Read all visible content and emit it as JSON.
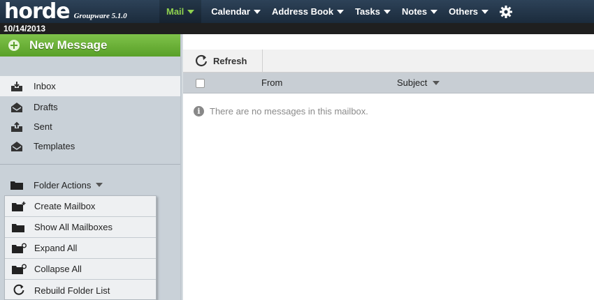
{
  "header": {
    "logo_text": "horde",
    "logo_subtitle": "Groupware 5.1.0",
    "nav": [
      {
        "label": "Mail"
      },
      {
        "label": "Calendar"
      },
      {
        "label": "Address Book"
      },
      {
        "label": "Tasks"
      },
      {
        "label": "Notes"
      },
      {
        "label": "Others"
      }
    ],
    "settings_icon": "gear-icon"
  },
  "date": "10/14/2013",
  "sidebar": {
    "new_message_label": "New Message",
    "mailboxes": [
      {
        "label": "Inbox",
        "icon": "inbox-icon",
        "selected": true
      },
      {
        "label": "Drafts",
        "icon": "drafts-icon",
        "selected": false
      },
      {
        "label": "Sent",
        "icon": "sent-icon",
        "selected": false
      },
      {
        "label": "Templates",
        "icon": "templates-icon",
        "selected": false
      }
    ],
    "folder_actions_label": "Folder Actions",
    "folder_menu": [
      {
        "label": "Create Mailbox",
        "icon": "folder-new-icon"
      },
      {
        "label": "Show All Mailboxes",
        "icon": "folder-icon"
      },
      {
        "label": "Expand All",
        "icon": "folder-expand-icon"
      },
      {
        "label": "Collapse All",
        "icon": "folder-collapse-icon"
      },
      {
        "label": "Rebuild Folder List",
        "icon": "refresh-icon"
      }
    ]
  },
  "toolbar": {
    "refresh_label": "Refresh"
  },
  "message_list": {
    "columns": [
      "From",
      "Subject"
    ],
    "empty_text": "There are no messages in this mailbox."
  },
  "colors": {
    "topbar": "#1b2b3c",
    "active_nav": "#8fd14f",
    "new_message": "#6cb13a",
    "sidebar": "#c9d1d8"
  }
}
